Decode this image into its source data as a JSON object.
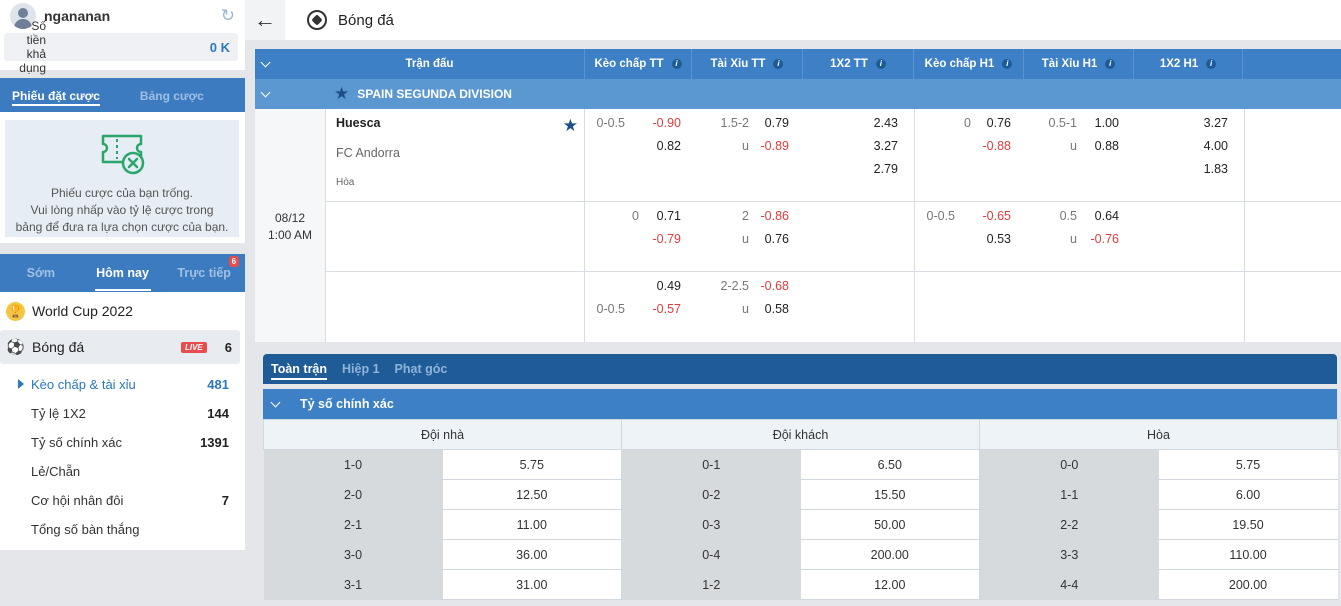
{
  "user": {
    "name": "ngananan",
    "balance_label": "Số tiền khả dụng",
    "balance_value": "0 K"
  },
  "bet_slip": {
    "tabs": [
      "Phiếu đặt cược",
      "Bảng cược"
    ],
    "empty_line1": "Phiếu cược của bạn trống.",
    "empty_line2": "Vui lòng nhấp vào tỷ lệ cược trong",
    "empty_line3": "bảng để đưa ra lựa chọn cược của bạn."
  },
  "menu": {
    "tabs": [
      "Sớm",
      "Hôm nay",
      "Trực tiếp"
    ],
    "live_badge_count": "6",
    "sports": [
      {
        "name": "World Cup 2022",
        "count": ""
      },
      {
        "name": "Bóng đá",
        "count": "6",
        "live": "LIVE"
      }
    ],
    "sub_items": [
      {
        "label": "Kèo chấp & tài xỉu",
        "count": "481"
      },
      {
        "label": "Tỷ lệ 1X2",
        "count": "144"
      },
      {
        "label": "Tỷ số chính xác",
        "count": "1391"
      },
      {
        "label": "Lẻ/Chẵn",
        "count": ""
      },
      {
        "label": "Cơ hội nhân đôi",
        "count": "7"
      },
      {
        "label": "Tổng số bàn thắng",
        "count": ""
      }
    ]
  },
  "header": {
    "title": "Bóng đá"
  },
  "odds_table": {
    "columns": [
      "Trận đấu",
      "Kèo chấp TT",
      "Tài Xỉu TT",
      "1X2 TT",
      "Kèo chấp H1",
      "Tài Xỉu H1",
      "1X2 H1"
    ],
    "league": "SPAIN SEGUNDA DIVISION",
    "match": {
      "date": "08/12",
      "time": "1:00 AM",
      "home": "Huesca",
      "away": "FC Andorra",
      "draw": "Hòa"
    },
    "rows": [
      {
        "hdp_ft": {
          "line": "0-0.5",
          "home": "-0.90",
          "away": "0.82"
        },
        "ou_ft": {
          "line": "1.5-2",
          "over": "0.79",
          "u": "u",
          "under": "-0.89"
        },
        "x12_ft": [
          "2.43",
          "3.27",
          "2.79"
        ],
        "hdp_h1": {
          "line": "0",
          "home": "0.76",
          "away": "-0.88"
        },
        "ou_h1": {
          "line": "0.5-1",
          "over": "1.00",
          "u": "u",
          "under": "0.88"
        },
        "x12_h1": [
          "3.27",
          "4.00",
          "1.83"
        ]
      },
      {
        "hdp_ft": {
          "line": "0",
          "home": "0.71",
          "away": "-0.79"
        },
        "ou_ft": {
          "line": "2",
          "over": "-0.86",
          "u": "u",
          "under": "0.76"
        },
        "hdp_h1": {
          "line": "0-0.5",
          "home": "-0.65",
          "away": "0.53"
        },
        "ou_h1": {
          "line": "0.5",
          "over": "0.64",
          "u": "u",
          "under": "-0.76"
        }
      },
      {
        "hdp_ft": {
          "line": "0-0.5",
          "home": "0.49",
          "away": "-0.57"
        },
        "ou_ft": {
          "line": "2-2.5",
          "over": "-0.68",
          "u": "u",
          "under": "0.58"
        }
      }
    ]
  },
  "bottom": {
    "tabs": [
      "Toàn trận",
      "Hiệp 1",
      "Phạt góc"
    ],
    "section_title": "Tỷ số chính xác",
    "headers": [
      "Đội nhà",
      "Đội khách",
      "Hòa"
    ],
    "rows": [
      {
        "home": [
          "1-0",
          "5.75"
        ],
        "away": [
          "0-1",
          "6.50"
        ],
        "draw": [
          "0-0",
          "5.75"
        ]
      },
      {
        "home": [
          "2-0",
          "12.50"
        ],
        "away": [
          "0-2",
          "15.50"
        ],
        "draw": [
          "1-1",
          "6.00"
        ]
      },
      {
        "home": [
          "2-1",
          "11.00"
        ],
        "away": [
          "0-3",
          "50.00"
        ],
        "draw": [
          "2-2",
          "19.50"
        ]
      },
      {
        "home": [
          "3-0",
          "36.00"
        ],
        "away": [
          "0-4",
          "200.00"
        ],
        "draw": [
          "3-3",
          "110.00"
        ]
      },
      {
        "home": [
          "3-1",
          "31.00"
        ],
        "away": [
          "1-2",
          "12.00"
        ],
        "draw": [
          "4-4",
          "200.00"
        ]
      }
    ]
  },
  "colors": {
    "primary": "#3d80c6",
    "dark_primary": "#1f5c97",
    "negative": "#e03c3c",
    "live": "#e84c4c"
  }
}
